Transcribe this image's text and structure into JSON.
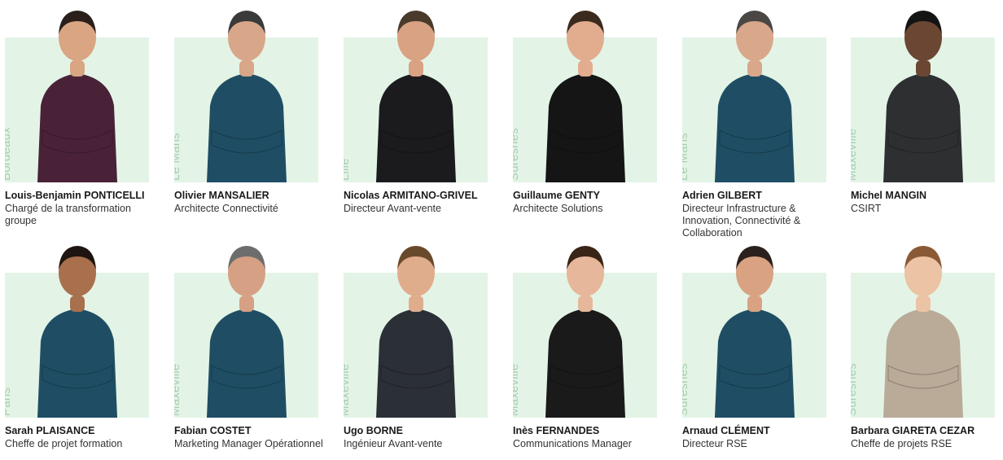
{
  "people": [
    {
      "name": "Louis-Benjamin PONTICELLI",
      "role": "Chargé de la transformation groupe",
      "city": "Bordeaux",
      "shirt": "#4a2238",
      "skin": "#d9a582",
      "hair": "#2a1f1a"
    },
    {
      "name": "Olivier MANSALIER",
      "role": "Architecte Connectivité",
      "city": "Le Mans",
      "shirt": "#1f4e64",
      "skin": "#d8a688",
      "hair": "#3a3a3a"
    },
    {
      "name": "Nicolas ARMITANO-GRIVEL",
      "role": "Directeur Avant-vente",
      "city": "Lille",
      "shirt": "#1b1b1d",
      "skin": "#d8a283",
      "hair": "#4a3a2c"
    },
    {
      "name": "Guillaume GENTY",
      "role": "Architecte Solutions",
      "city": "Suresnes",
      "shirt": "#151515",
      "skin": "#e2ac8e",
      "hair": "#3b2a1e"
    },
    {
      "name": "Adrien GILBERT",
      "role": "Directeur Infrastructure & Innovation, Connectivité & Collaboration",
      "city": "Le Mans",
      "shirt": "#1f4e64",
      "skin": "#d9a78a",
      "hair": "#4a4744"
    },
    {
      "name": "Michel MANGIN",
      "role": "CSIRT",
      "city": "Maxéville",
      "shirt": "#2d2f31",
      "skin": "#6b4733",
      "hair": "#141414"
    },
    {
      "name": "Sarah PLAISANCE",
      "role": "Cheffe de projet formation",
      "city": "Paris",
      "shirt": "#1f4e64",
      "skin": "#a8704d",
      "hair": "#1f1510"
    },
    {
      "name": "Fabian COSTET",
      "role": "Marketing Manager Opérationnel",
      "city": "Maxéville",
      "shirt": "#1f4e64",
      "skin": "#d6a084",
      "hair": "#6d6d6d"
    },
    {
      "name": "Ugo BORNE",
      "role": "Ingénieur Avant-vente",
      "city": "Maxéville",
      "shirt": "#2b2f36",
      "skin": "#e0ad8c",
      "hair": "#6a4a2c"
    },
    {
      "name": "Inès FERNANDES",
      "role": "Communications Manager",
      "city": "Maxéville",
      "shirt": "#1a1a1a",
      "skin": "#e6b79a",
      "hair": "#3a2418"
    },
    {
      "name": "Arnaud CLÉMENT",
      "role": "Directeur RSE",
      "city": "Suresnes",
      "shirt": "#1f4e64",
      "skin": "#d8a283",
      "hair": "#2a211c"
    },
    {
      "name": "Barbara GIARETA CEZAR",
      "role": "Cheffe de projets RSE",
      "city": "Suresnes",
      "shirt": "#b9ab98",
      "skin": "#ecc3a5",
      "hair": "#8a5a36"
    }
  ]
}
